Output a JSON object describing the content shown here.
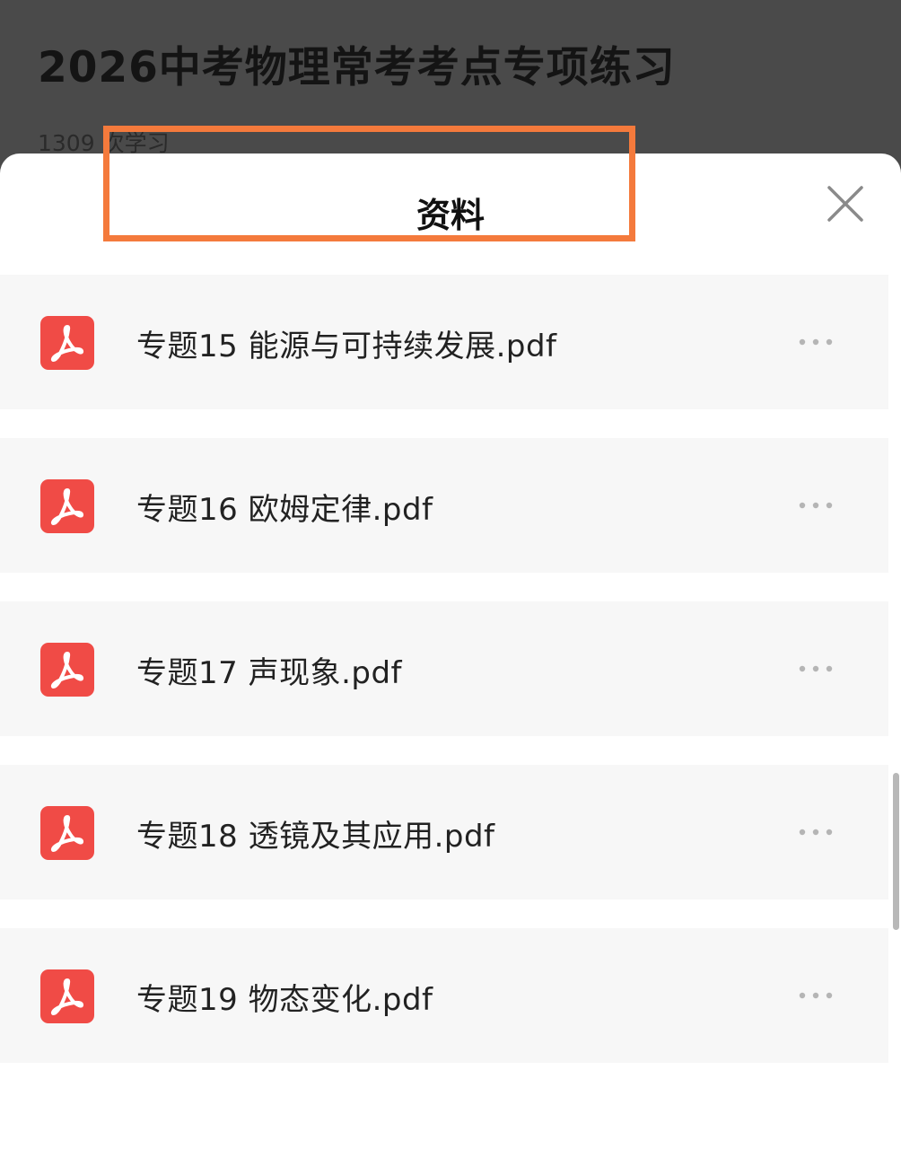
{
  "background_page": {
    "title": "2026中考物理常考考点专项练习",
    "study_count": "1309 次学习"
  },
  "sheet": {
    "title": "资料",
    "close_icon": "close-icon",
    "files": [
      {
        "name": "专题15 能源与可持续发展.pdf",
        "icon": "pdf-icon",
        "highlighted": true
      },
      {
        "name": "专题16 欧姆定律.pdf",
        "icon": "pdf-icon",
        "highlighted": false
      },
      {
        "name": "专题17 声现象.pdf",
        "icon": "pdf-icon",
        "highlighted": false
      },
      {
        "name": "专题18 透镜及其应用.pdf",
        "icon": "pdf-icon",
        "highlighted": false
      },
      {
        "name": "专题19 物态变化.pdf",
        "icon": "pdf-icon",
        "highlighted": false
      }
    ],
    "more_icon": "more-dots-icon"
  },
  "colors": {
    "pdf_icon": "#f04b46",
    "highlight_border": "#f47a3c",
    "overlay": "#474747"
  }
}
